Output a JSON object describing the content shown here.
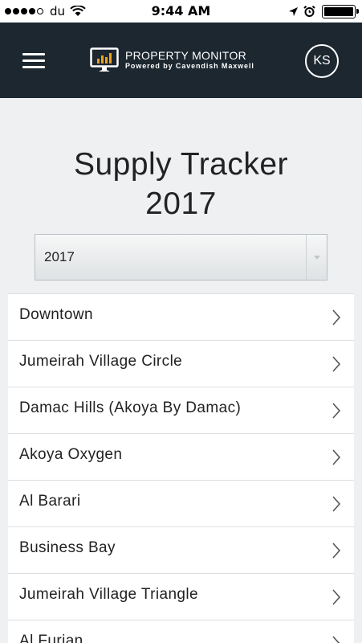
{
  "status_bar": {
    "carrier": "du",
    "time": "9:44 AM"
  },
  "header": {
    "brand_title": "PROPERTY MONITOR",
    "brand_subtitle": "Powered by Cavendish Maxwell",
    "avatar_initials": "KS"
  },
  "page": {
    "title_line1": "Supply Tracker",
    "title_line2": "2017"
  },
  "year_select": {
    "value": "2017"
  },
  "areas": [
    "Downtown",
    "Jumeirah Village Circle",
    "Damac Hills (Akoya By Damac)",
    "Akoya Oxygen",
    "Al Barari",
    "Business Bay",
    "Jumeirah Village Triangle",
    "Al Furjan"
  ],
  "colors": {
    "nav_bg": "#1c2730",
    "page_bg": "#eef0f1",
    "logo_bar_accent": "#f0a020"
  }
}
